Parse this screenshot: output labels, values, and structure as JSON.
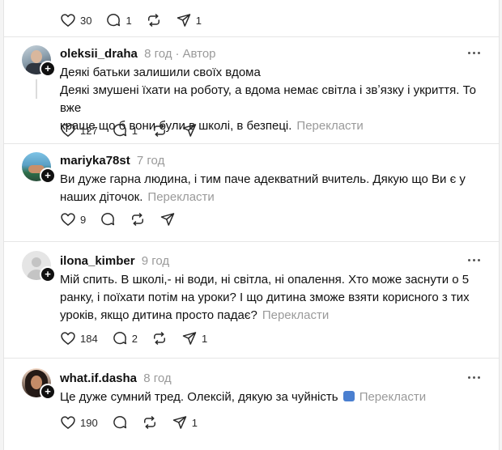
{
  "top_post": {
    "actions": {
      "like": "30",
      "reply": "1",
      "repost": "",
      "share": "1"
    }
  },
  "posts": [
    {
      "username": "oleksii_draha",
      "time": "8 год",
      "author_badge": "Автор",
      "line1": "Деякі батьки залишили своїх вдома",
      "line2": "Деякі змушені їхати на роботу, а вдома немає світла і звʼязку і укриття. То вже",
      "line3": "краще що б вони були в школі, в безпеці.",
      "translate": "Перекласти",
      "actions": {
        "like": "127",
        "reply": "1",
        "repost": "",
        "share": ""
      }
    },
    {
      "username": "mariyka78st",
      "time": "7 год",
      "line1": "Ви дуже гарна людина, і тим паче адекватний вчитель. Дякую що Ви є у",
      "line2": "наших діточок.",
      "translate": "Перекласти",
      "actions": {
        "like": "9",
        "reply": "",
        "repost": "",
        "share": ""
      }
    },
    {
      "username": "ilona_kimber",
      "time": "9 год",
      "line1": "Мій спить. В школі,- ні води, ні світла, ні опалення. Хто може заснути о 5",
      "line2": "ранку, і поїхати потім на уроки? І що дитина зможе взяти корисного з тих",
      "line3": "уроків, якщо дитина просто падає?",
      "translate": "Перекласти",
      "actions": {
        "like": "184",
        "reply": "2",
        "repost": "",
        "share": "1"
      }
    },
    {
      "username": "what.if.dasha",
      "time": "8 год",
      "line1": "Це дуже сумний тред. Олексій, дякую за чуйність",
      "translate": "Перекласти",
      "actions": {
        "like": "190",
        "reply": "",
        "repost": "",
        "share": "1"
      }
    }
  ],
  "icons": {
    "like": "heart-icon",
    "reply": "comment-icon",
    "repost": "repost-icon",
    "share": "share-icon",
    "more": "more-options-icon",
    "follow": "plus-icon"
  },
  "colors": {
    "text": "#101010",
    "muted": "#9a9a9a",
    "divider": "#e6e6e6"
  }
}
